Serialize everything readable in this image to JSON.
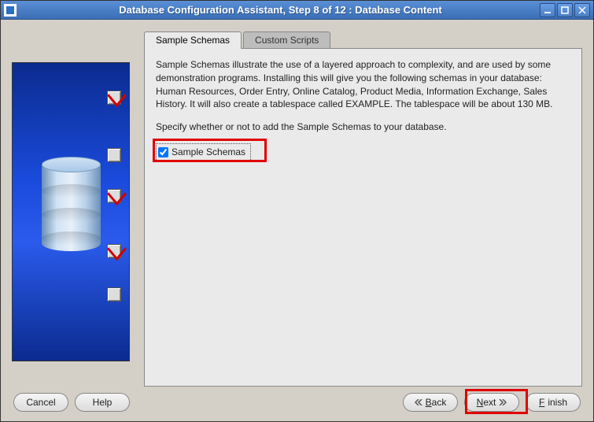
{
  "titlebar": {
    "title": "Database Configuration Assistant, Step 8 of 12 : Database Content"
  },
  "tabs": {
    "sample": "Sample Schemas",
    "custom": "Custom Scripts"
  },
  "body": {
    "paragraph": "Sample Schemas illustrate the use of a layered approach to complexity, and are used by some demonstration programs. Installing this will give you the following schemas in your database: Human Resources, Order Entry, Online Catalog, Product Media, Information Exchange, Sales History. It will also create a tablespace called EXAMPLE. The tablespace will be about 130 MB.",
    "instruction": "Specify whether or not to add the Sample Schemas to your database.",
    "checkbox_label": "Sample Schemas",
    "checkbox_checked": true
  },
  "side": {
    "items": [
      {
        "checked": true
      },
      {
        "checked": false
      },
      {
        "checked": true
      },
      {
        "checked": true
      },
      {
        "checked": false
      }
    ]
  },
  "buttons": {
    "cancel": "Cancel",
    "help": "Help",
    "back": "Back",
    "next": "Next",
    "finish": "Finish"
  }
}
